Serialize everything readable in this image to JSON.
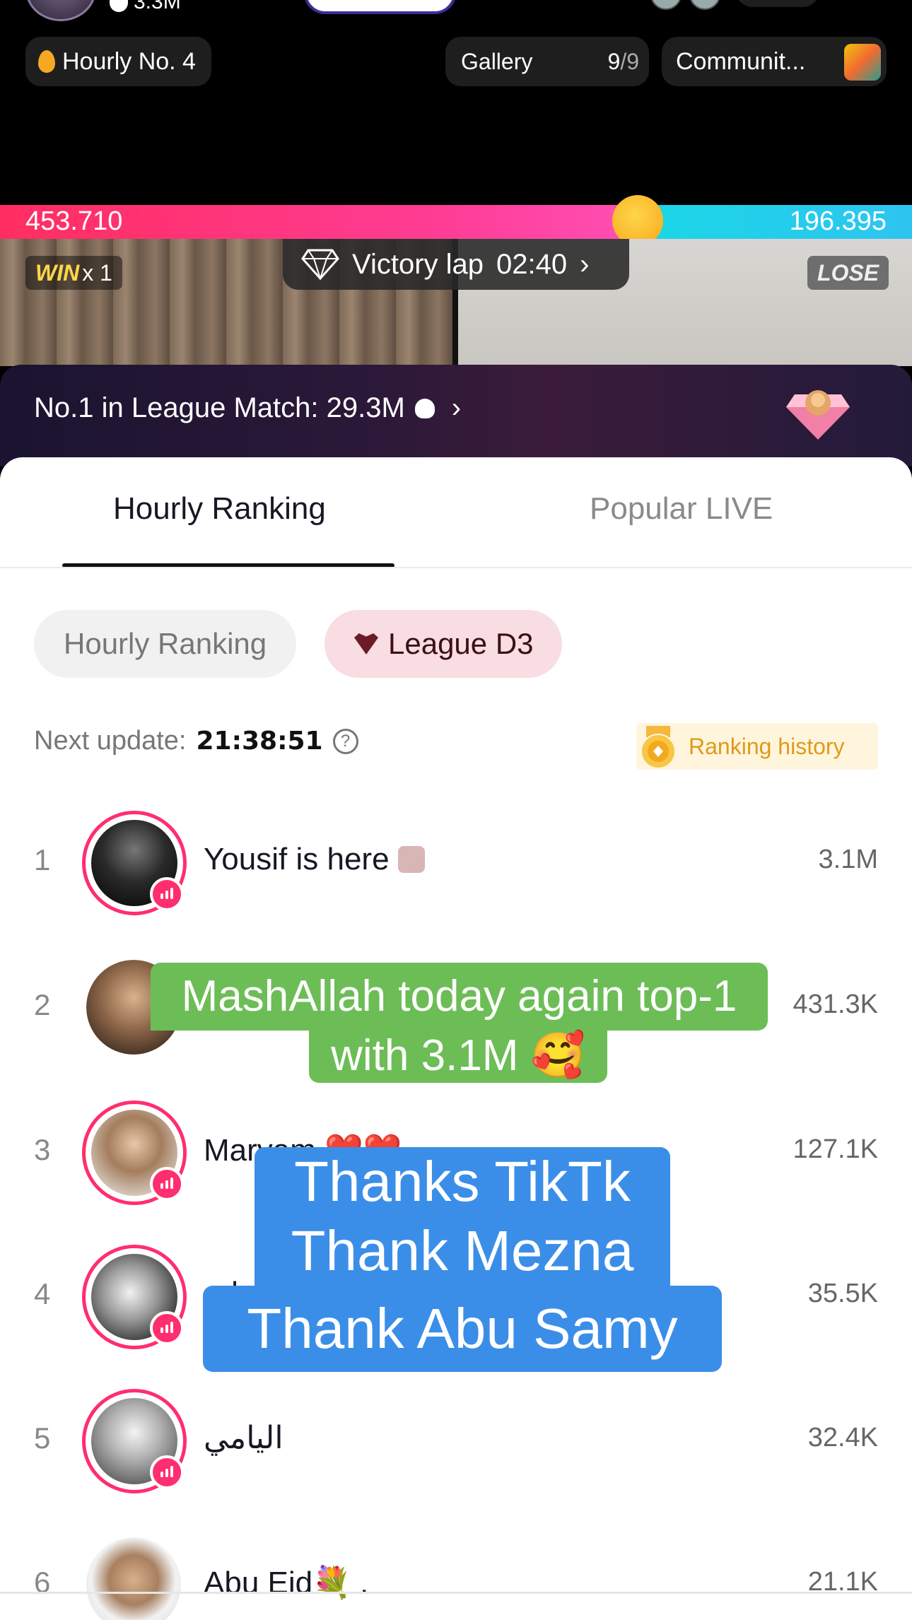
{
  "top": {
    "viewer_count": "3.3M",
    "hourly_badge": "Hourly No. 4",
    "gallery": {
      "label": "Gallery",
      "count": "9",
      "total": "/9"
    },
    "community": "Communit..."
  },
  "battle": {
    "left_score": "453.710",
    "right_score": "196.395",
    "win_label": "WIN",
    "win_count": "x 1",
    "lose_label": "LOSE",
    "victory_label": "Victory lap",
    "victory_time": "02:40",
    "left_share": 0.696
  },
  "league_banner": "No.1 in League Match: 29.3M",
  "tabs": [
    {
      "label": "Hourly Ranking",
      "active": true
    },
    {
      "label": "Popular LIVE",
      "active": false
    }
  ],
  "chips": {
    "hourly": "Hourly Ranking",
    "league": "League D3"
  },
  "update": {
    "label": "Next update:",
    "time": "21:38:51"
  },
  "history_label": "Ranking history",
  "rows": [
    {
      "rank": "1",
      "name": "Yousif is here",
      "score": "3.1M"
    },
    {
      "rank": "2",
      "name": "",
      "score": "431.3K"
    },
    {
      "rank": "3",
      "name": "Maryam ❤️❤️",
      "score": "127.1K"
    },
    {
      "rank": "4",
      "name": "ed",
      "score": "35.5K"
    },
    {
      "rank": "5",
      "name": "اليامي",
      "score": "32.4K"
    },
    {
      "rank": "6",
      "name": "Abu Eid💐 .",
      "score": "21.1K"
    }
  ],
  "captions": {
    "green_line1": "MashAllah today again top-1",
    "green_line2": "with 3.1M 🥰",
    "blue_line1": "Thanks TikTk",
    "blue_line2": "Thank Mezna",
    "blue_line3": "Thank Abu Samy"
  },
  "colors": {
    "accent": "#ff2e6e",
    "left_bar": "#ff2d61",
    "right_bar": "#1ad7e6",
    "green_caption": "#6cbd56",
    "blue_caption": "#3b8ee8"
  }
}
